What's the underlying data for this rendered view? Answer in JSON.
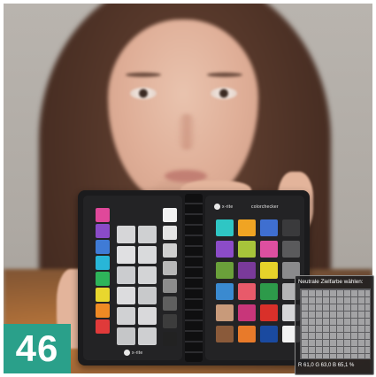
{
  "photo": {
    "subject": "portrait",
    "accent_color": "#2aa08a"
  },
  "page_badge": {
    "number": "46"
  },
  "color_checker": {
    "left_brand": "x-rite",
    "right_brand": "x-rite",
    "right_logo": "colorchecker",
    "left_strip_colors": [
      "#e0489a",
      "#8a4bc8",
      "#3f7bd6",
      "#28b6d8",
      "#2eb45a",
      "#e8d72e",
      "#ef8a24",
      "#e03a3a"
    ],
    "white_patches": [
      "#d6d6d8",
      "#cfd0d2",
      "#e0e0e2",
      "#d9dadc",
      "#cbcccf",
      "#d3d4d6",
      "#dcdcde",
      "#c8c9cb",
      "#d0d1d3",
      "#d9d9db",
      "#c5c6c8",
      "#cecfd1"
    ],
    "gray_column": [
      "#f2f2f2",
      "#e4e4e4",
      "#d0d0d0",
      "#b8b8b8",
      "#8c8c8c",
      "#5f5f5f",
      "#3c3c3c",
      "#222222"
    ],
    "classic_patches": [
      "#2fc6c4",
      "#f0a423",
      "#3f6fd0",
      "#3a3a3c",
      "#8c4cc8",
      "#a7c43a",
      "#dd4fa0",
      "#5a5a5c",
      "#6aa03a",
      "#7a3a9a",
      "#e6d22a",
      "#8a8a8c",
      "#3a8ad0",
      "#e85a6a",
      "#2d9a4a",
      "#b4b4b6",
      "#c89a7a",
      "#c8367a",
      "#d9302a",
      "#d6d6d8",
      "#8a5a3a",
      "#e87a2a",
      "#1a4aa0",
      "#f2f2f2"
    ]
  },
  "picker": {
    "title": "Neutrale Zielfarbe wählen:",
    "readout": "R 61,0  G 63,0  B 65,1 %"
  }
}
